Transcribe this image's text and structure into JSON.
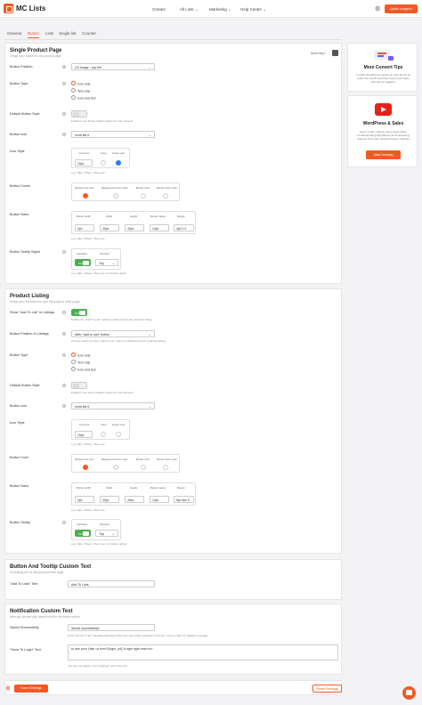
{
  "header": {
    "logo_text": "MC Lists",
    "nav": [
      {
        "label": "Creator"
      },
      {
        "label": "All Lists ⌄"
      },
      {
        "label": "Marketing ⌄"
      },
      {
        "label": "Help Center ⌄"
      }
    ],
    "quick_support": "Quick support"
  },
  "tabs": [
    "General",
    "Button",
    "Lists",
    "Single list",
    "Counter"
  ],
  "active_tab": "Button",
  "product_page": {
    "title": "Single Product Page",
    "subtitle": "Design your button for your product page",
    "need_help": "Need help?",
    "position": {
      "label": "Button Position",
      "value": "On image - top left"
    },
    "type": {
      "label": "Button Type",
      "options": [
        "Icon only",
        "Text only",
        "Icon and text"
      ]
    },
    "default_style": {
      "label": "Default Button Style",
      "note": "Enable if use theme default styles for icon and text"
    },
    "icon": {
      "label": "Button Icon",
      "value": "multi-list 6"
    },
    "icon_style": {
      "label": "Icon Style",
      "cols": [
        "Font size",
        "Color",
        "Hover color"
      ],
      "font_size": "15px"
    },
    "colors": {
      "label": "Button Colors",
      "cols": [
        "Background color",
        "Background hover color",
        "Border color",
        "Border hover color"
      ]
    },
    "sizes": {
      "label": "Button Sizes",
      "cols": [
        "Border width",
        "Width",
        "Height",
        "Border radius",
        "Margin"
      ],
      "values": [
        "0px",
        "40px",
        "40px",
        "12px",
        "4px 0 0"
      ],
      "note": "e.g. 10px, 15rem, 15em etc."
    },
    "tooltip": {
      "label": "Button Tooltip Styles",
      "cols": [
        "Activation",
        "Direction"
      ],
      "toggle": "ON",
      "direction": "Top",
      "note": "e.g. 10px, 15rem, 15em etc. for border radius"
    }
  },
  "product_listing": {
    "title": "Product Listing",
    "subtitle": "Design your list button for your lists page or other pages",
    "show_add": {
      "label": "Show \"Add To List\" In Listings",
      "toggle": "ON",
      "note": "Enable the \"Add To List\" feature in WooCommerce products listing"
    },
    "position": {
      "label": "Button Position In Listings",
      "value": "After \"add to cart\" button",
      "note": "Choose where to show \"Add to List\" button in WooCommerce products listing"
    },
    "type": {
      "label": "Button Type",
      "options": [
        "Icon only",
        "Text only",
        "Icon and text"
      ]
    },
    "default_style": {
      "label": "Default Button Style",
      "note": "Enable if use theme default styles for icon and text"
    },
    "icon": {
      "label": "Button Icon",
      "value": "multi-list 6"
    },
    "icon_style": {
      "label": "Icon Style",
      "cols": [
        "Font size",
        "Color",
        "Hover color"
      ],
      "font_size": "15px",
      "note": "e.g. 10px, 15rem, 15em etc."
    },
    "color": {
      "label": "Button Color",
      "cols": [
        "Background color",
        "Background hover color",
        "Border color",
        "Border hover color"
      ]
    },
    "sizes": {
      "label": "Button Sizes",
      "cols": [
        "Border width",
        "Width",
        "Height",
        "Border radius",
        "Margin"
      ],
      "values": [
        "0px",
        "40px",
        "40px",
        "12px",
        "5px 0px 0"
      ],
      "note": "e.g. 10px, 15rem, 15em etc."
    },
    "tooltip": {
      "label": "Button Tooltip",
      "cols": [
        "Activation",
        "Direction"
      ],
      "toggle": "ON",
      "direction": "Top",
      "note": "e.g. 10px, 15rem, 15em etc. for border radius"
    }
  },
  "custom_text": {
    "title": "Button And Tooltip Custom Text",
    "subtitle": "All settings are for listing and product page",
    "add_label": "\"Add To Lists\" Text",
    "add_value": "Add To Lists"
  },
  "notification": {
    "title": "Notification Custom Text",
    "subtitle": "Here you choose your desired text for the below notices",
    "saved_label": "Saved Successfully",
    "saved_value": "Saved successfully!",
    "saved_note": "Enter the text of the message displayed when the user adds a product to the list. Leave empty for disable message",
    "login_label": "\"Have To Login\" Text",
    "login_value": "to use your Lists <a href='{login_url}'>Login right now</a>",
    "login_note": "You can use {login_url} or {signup_url} in the text"
  },
  "sidebar": {
    "tips_title": "More Convert Tips",
    "tips_text": "Let MC WooPlan be active on your list for at least one month and then boost your sales through its analytics",
    "wp_title": "WordPress & Sales",
    "wp_text": "Learn it here: videos every week about troubleshooting WordPress and increasing revenue from your WooCommerce website",
    "wp_button": "Start Growing"
  },
  "footer": {
    "save": "Save Settings",
    "reset": "Reset Settings"
  },
  "colors": {
    "accent": "#f15a24",
    "toggle_on": "#4caf50"
  }
}
